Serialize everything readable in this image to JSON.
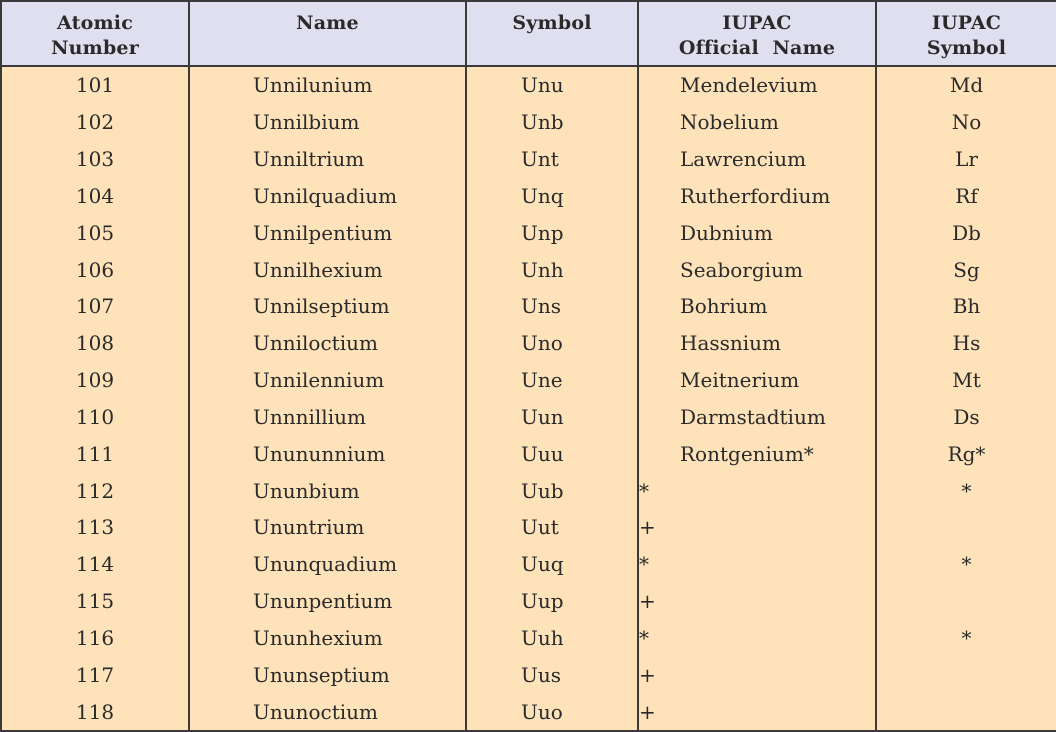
{
  "table": {
    "headers": [
      {
        "lines": [
          "Atomic",
          "Number"
        ]
      },
      {
        "lines": [
          "Name"
        ]
      },
      {
        "lines": [
          "Symbol"
        ]
      },
      {
        "lines": [
          "IUPAC",
          "Official  Name"
        ]
      },
      {
        "lines": [
          "IUPAC",
          "Symbol"
        ]
      }
    ],
    "rows": [
      {
        "atomic_number": "101",
        "name": "Unnilunium",
        "symbol": "Unu",
        "iupac_name": "Mendelevium",
        "iupac_symbol": "Md"
      },
      {
        "atomic_number": "102",
        "name": "Unnilbium",
        "symbol": "Unb",
        "iupac_name": "Nobelium",
        "iupac_symbol": "No"
      },
      {
        "atomic_number": "103",
        "name": "Unniltrium",
        "symbol": "Unt",
        "iupac_name": "Lawrencium",
        "iupac_symbol": "Lr"
      },
      {
        "atomic_number": "104",
        "name": "Unnilquadium",
        "symbol": "Unq",
        "iupac_name": "Rutherfordium",
        "iupac_symbol": "Rf"
      },
      {
        "atomic_number": "105",
        "name": "Unnilpentium",
        "symbol": "Unp",
        "iupac_name": "Dubnium",
        "iupac_symbol": "Db"
      },
      {
        "atomic_number": "106",
        "name": "Unnilhexium",
        "symbol": "Unh",
        "iupac_name": "Seaborgium",
        "iupac_symbol": "Sg"
      },
      {
        "atomic_number": "107",
        "name": "Unnilseptium",
        "symbol": "Uns",
        "iupac_name": "Bohrium",
        "iupac_symbol": "Bh"
      },
      {
        "atomic_number": "108",
        "name": "Unniloctium",
        "symbol": "Uno",
        "iupac_name": "Hassnium",
        "iupac_symbol": "Hs"
      },
      {
        "atomic_number": "109",
        "name": "Unnilennium",
        "symbol": "Une",
        "iupac_name": "Meitnerium",
        "iupac_symbol": "Mt"
      },
      {
        "atomic_number": "110",
        "name": "Unnnillium",
        "symbol": "Uun",
        "iupac_name": "Darmstadtium",
        "iupac_symbol": "Ds"
      },
      {
        "atomic_number": "111",
        "name": "Unununnium",
        "symbol": "Uuu",
        "iupac_name": "Rontgenium*",
        "iupac_symbol": "Rg*"
      },
      {
        "atomic_number": "112",
        "name": "Ununbium",
        "symbol": "Uub",
        "iupac_name": "*",
        "iupac_symbol": "*"
      },
      {
        "atomic_number": "113",
        "name": "Ununtrium",
        "symbol": "Uut",
        "iupac_name": "+",
        "iupac_symbol": ""
      },
      {
        "atomic_number": "114",
        "name": "Ununquadium",
        "symbol": "Uuq",
        "iupac_name": "*",
        "iupac_symbol": "*"
      },
      {
        "atomic_number": "115",
        "name": "Ununpentium",
        "symbol": "Uup",
        "iupac_name": "+",
        "iupac_symbol": ""
      },
      {
        "atomic_number": "116",
        "name": "Ununhexium",
        "symbol": "Uuh",
        "iupac_name": "*",
        "iupac_symbol": "*"
      },
      {
        "atomic_number": "117",
        "name": "Ununseptium",
        "symbol": "Uus",
        "iupac_name": "+",
        "iupac_symbol": ""
      },
      {
        "atomic_number": "118",
        "name": "Ununoctium",
        "symbol": "Uuo",
        "iupac_name": "+",
        "iupac_symbol": ""
      }
    ]
  },
  "colors": {
    "header_bg": "#e0dff0",
    "body_bg": "#fee2b9",
    "border": "#3a3a3a",
    "text": "#2a2a2a"
  }
}
